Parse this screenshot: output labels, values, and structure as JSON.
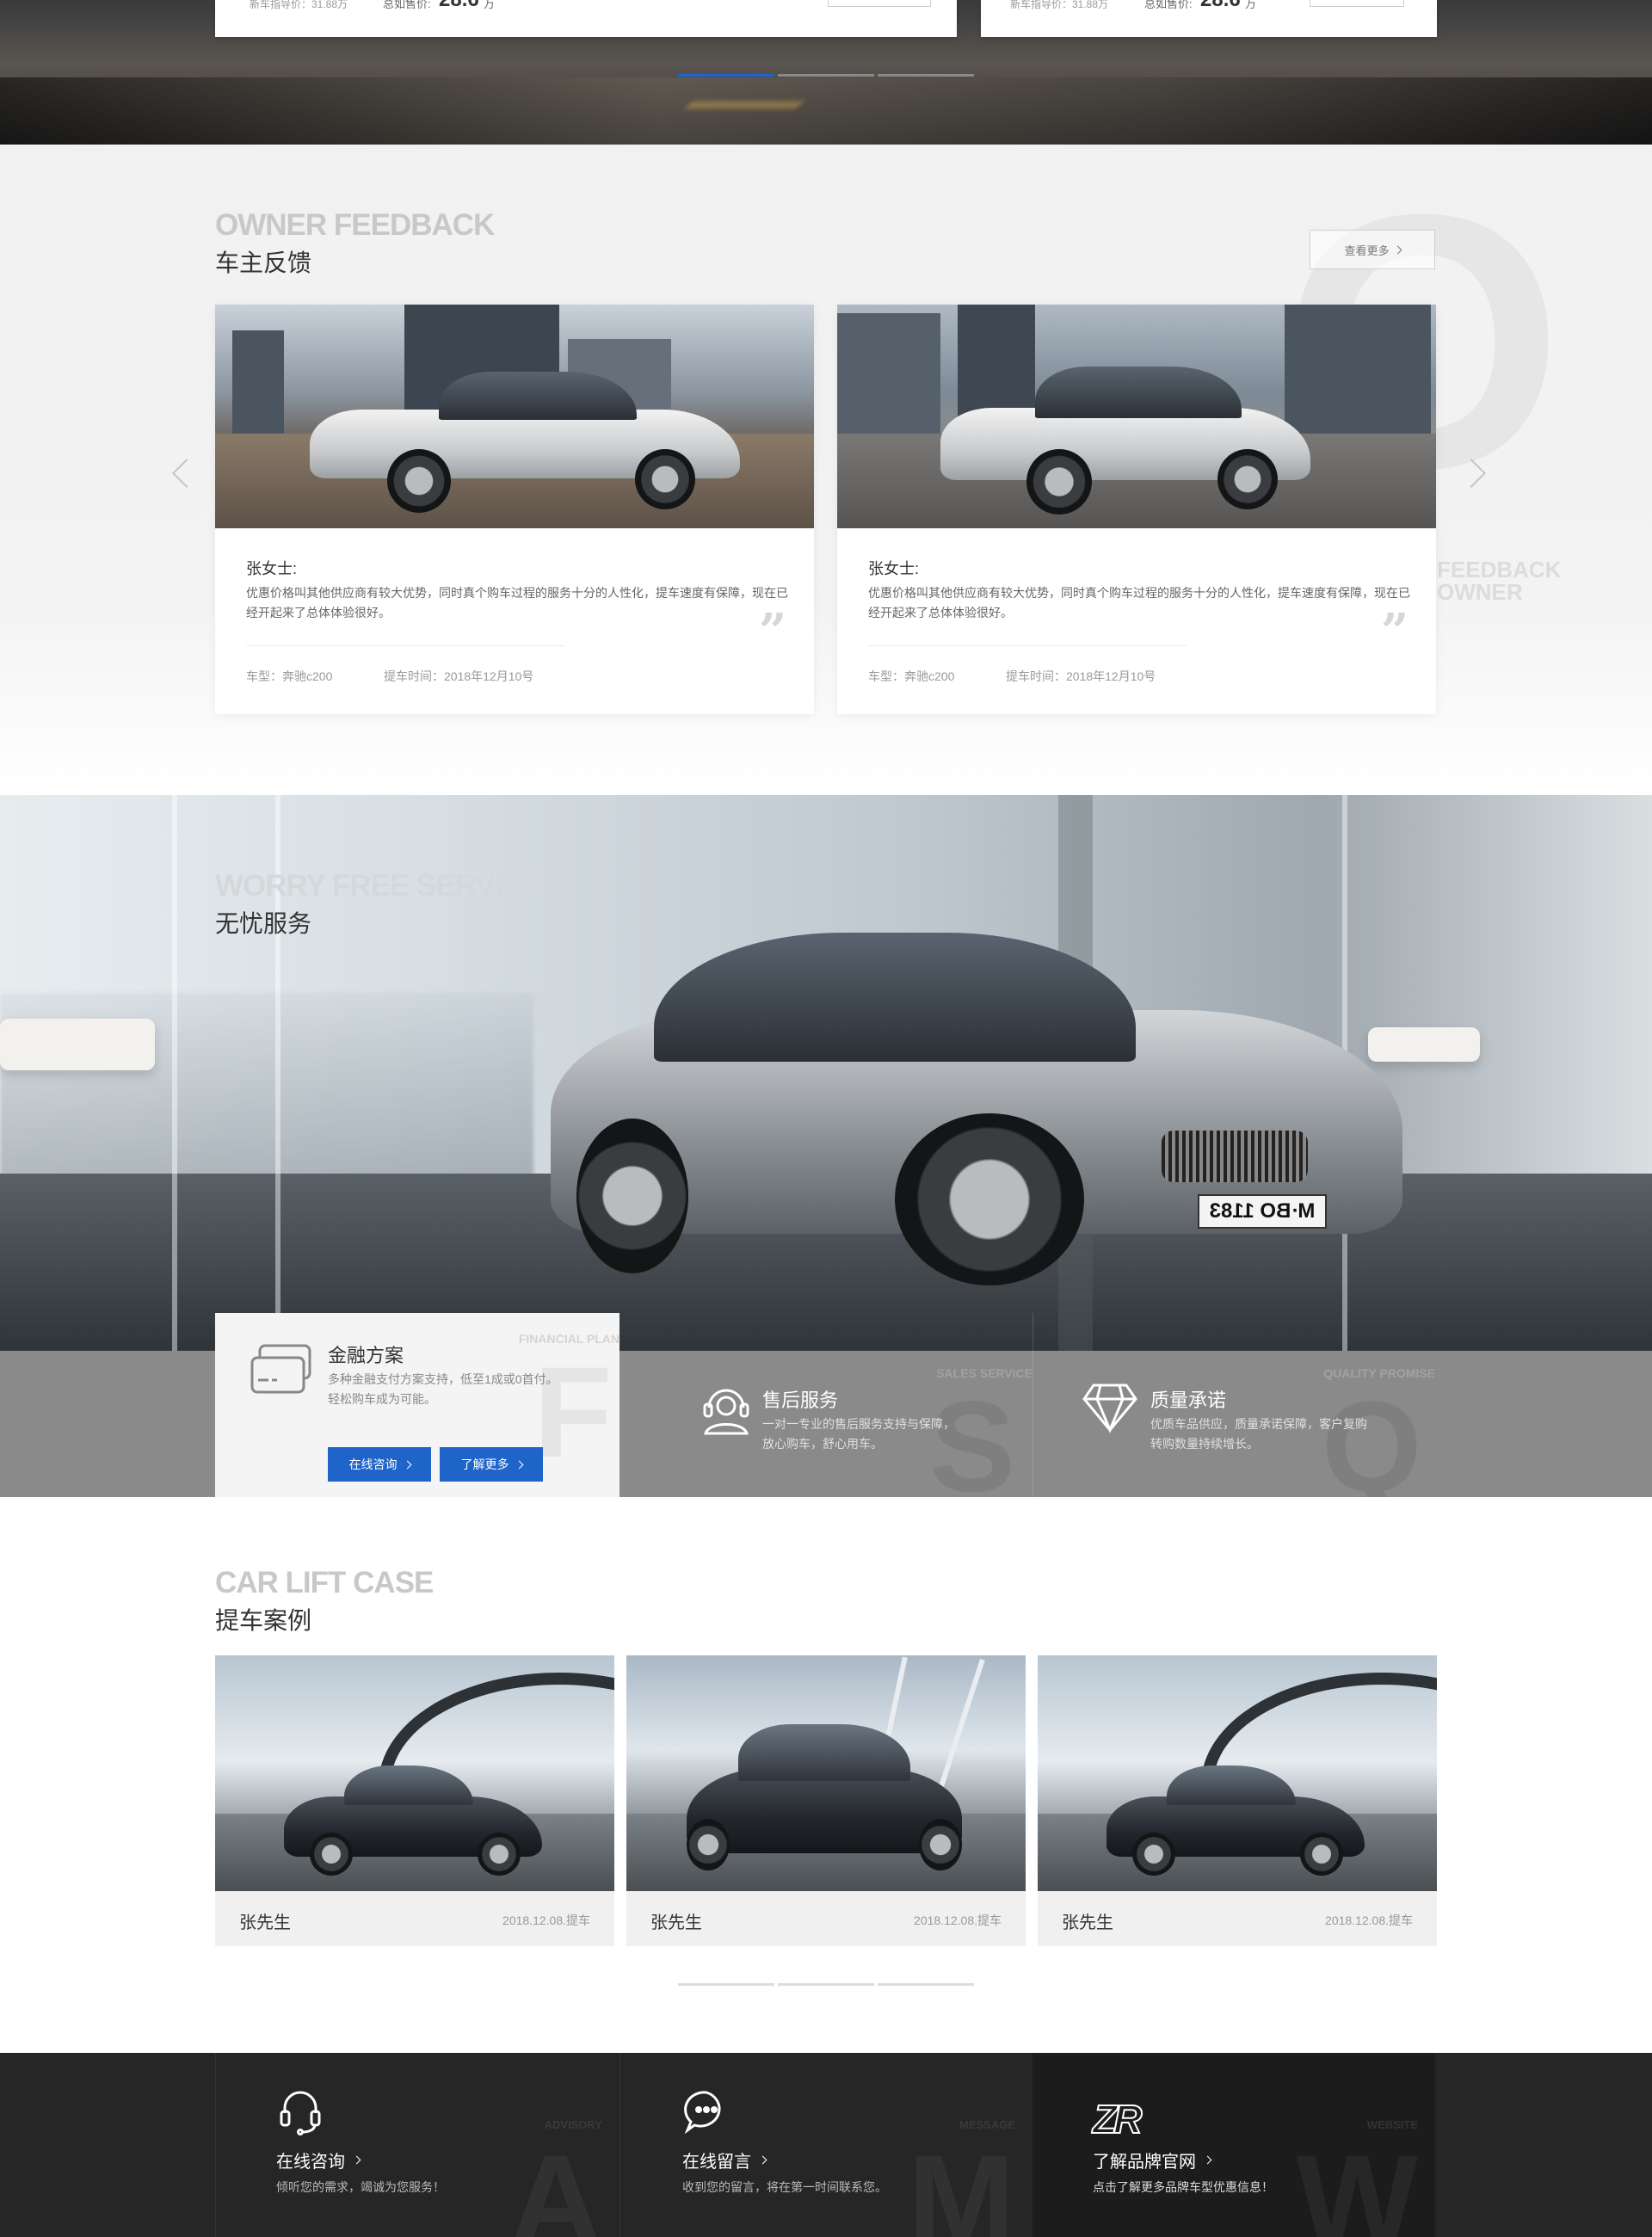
{
  "top": {
    "cards": [
      {
        "ref": "新车指导价：31.88万",
        "price_label": "总如售价:",
        "price": "28.6",
        "price_unit": "万"
      },
      {
        "ref": "新车指导价：31.88万",
        "price_label": "总如售价:",
        "price": "28.6",
        "price_unit": "万"
      }
    ],
    "carousel": {
      "count": 3,
      "active": 1
    }
  },
  "feedback": {
    "title_en": "OWNER FEEDBACK",
    "title_cn": "车主反馈",
    "more_label": "查看更多",
    "bg_letter": "O",
    "watermark_line1": "FEEDBACK",
    "watermark_line2": "OWNER",
    "cards": [
      {
        "name": "张女士:",
        "text": "优惠价格叫其他供应商有较大优势，同时真个购车过程的服务十分的人性化，提车速度有保障，现在已经开起来了总体体验很好。",
        "model": "车型：奔驰c200",
        "date": "提车时间：2018年12月10号"
      },
      {
        "name": "张女士:",
        "text": "优惠价格叫其他供应商有较大优势，同时真个购车过程的服务十分的人性化，提车速度有保障，现在已经开起来了总体体验很好。",
        "model": "车型：奔驰c200",
        "date": "提车时间：2018年12月10号"
      }
    ]
  },
  "service": {
    "title_en": "WORRY FREE SERVICE",
    "title_cn": "无忧服务",
    "plate": "M·BO 1183",
    "items": [
      {
        "en": "FINANCIAL PLAN",
        "letter": "F",
        "title": "金融方案",
        "desc_line1": "多种金融支付方案支持，低至1成或0首付。",
        "desc_line2": "轻松购车成为可能。",
        "btn_consult": "在线咨询",
        "btn_more": "了解更多"
      },
      {
        "en": "SALES SERVICE",
        "letter": "S",
        "title": "售后服务",
        "desc_line1": "一对一专业的售后服务支持与保障，",
        "desc_line2": "放心购车，舒心用车。"
      },
      {
        "en": "QUALITY PROMISE",
        "letter": "Q",
        "title": "质量承诺",
        "desc_line1": "优质车品供应，质量承诺保障，客户复购",
        "desc_line2": "转购数量持续增长。"
      }
    ]
  },
  "lift": {
    "title_en": "CAR LIFT CASE",
    "title_cn": "提车案例",
    "cards": [
      {
        "name": "张先生",
        "date": "2018.12.08.提车"
      },
      {
        "name": "张先生",
        "date": "2018.12.08.提车"
      },
      {
        "name": "张先生",
        "date": "2018.12.08.提车"
      }
    ],
    "carousel": {
      "count": 3,
      "active": 1
    }
  },
  "footer": {
    "items": [
      {
        "title": "在线咨询",
        "desc": "倾听您的需求，竭诚为您服务！",
        "en": "ADVISORY",
        "letter": "A",
        "icon": "headset-icon"
      },
      {
        "title": "在线留言",
        "desc": "收到您的留言，将在第一时间联系您。",
        "en": "MESSAGE",
        "letter": "M",
        "icon": "chat-bubble-icon"
      },
      {
        "title": "了解品牌官网",
        "desc": "点击了解更多品牌车型优惠信息！",
        "en": "WEBSITE",
        "letter": "W",
        "icon": "brand-logo-icon",
        "logo_text": "ZR"
      }
    ]
  },
  "colors": {
    "accent": "#1f64c8",
    "footer_bg": "#262626",
    "strip_bg": "#8a8a8a"
  }
}
